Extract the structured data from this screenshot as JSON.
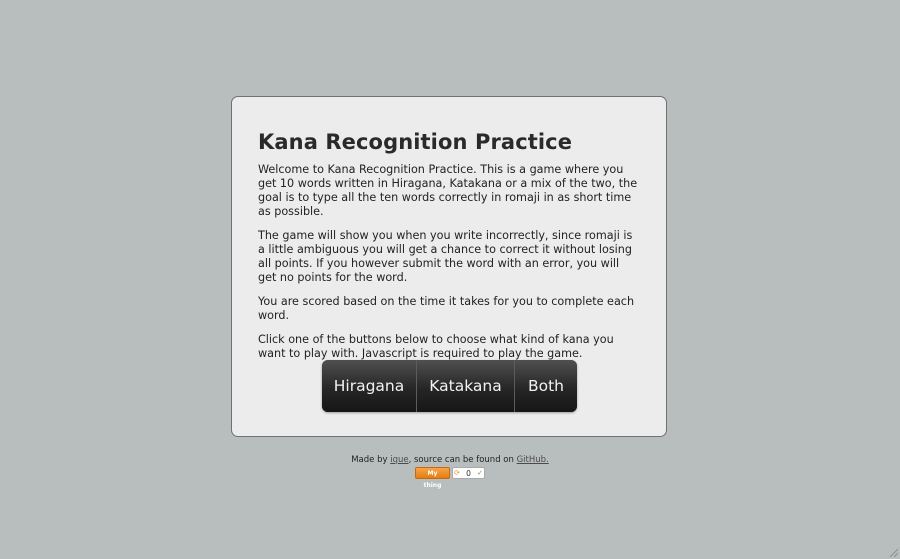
{
  "game": {
    "title": "Kana Recognition Practice",
    "paragraphs": [
      "Welcome to Kana Recognition Practice. This is a game where you get 10 words written in Hiragana, Katakana or a mix of the two, the goal is to type all the ten words correctly in romaji in as short time as possible.",
      "The game will show you when you write incorrectly, since romaji is a little ambiguous you will get a chance to correct it without losing all points. If you however submit the word with an error, you will get no points for the word.",
      "You are scored based on the time it takes for you to complete each word.",
      "Click one of the buttons below to choose what kind of kana you want to play with. Javascript is required to play the game."
    ],
    "buttons": {
      "hiragana": "Hiragana",
      "katakana": "Katakana",
      "both": "Both"
    }
  },
  "footer": {
    "made_by": "Made by ",
    "author": "ique",
    "mid": ", source can be found on ",
    "github": "GitHub."
  },
  "badge": {
    "label": "My thing",
    "count": "0",
    "icon_spinner": "spinner-icon",
    "icon_check": "check-icon"
  },
  "colors": {
    "background": "#b8bebe",
    "card": "#ececec",
    "button": "#222222",
    "badge": "#e47d12"
  }
}
